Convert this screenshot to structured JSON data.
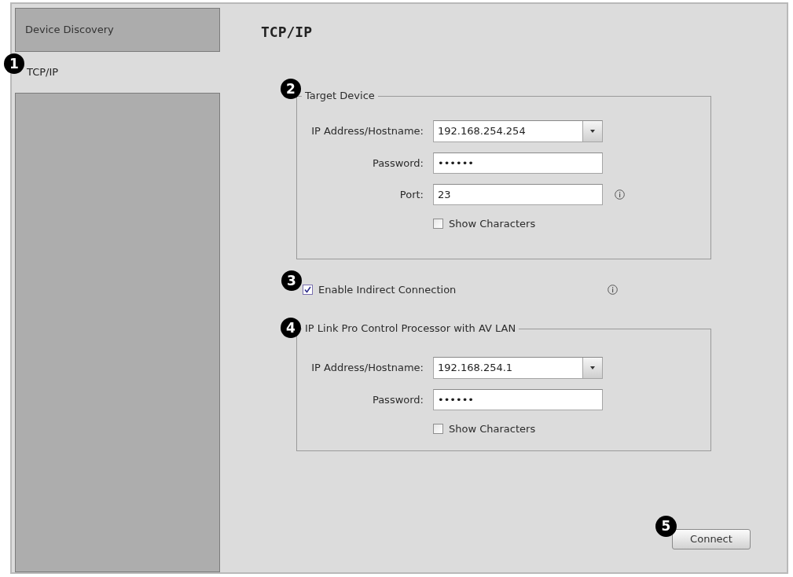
{
  "sidebar": {
    "items": [
      {
        "label": "Device Discovery",
        "selected": false
      },
      {
        "label": "TCP/IP",
        "selected": true,
        "callout": "1"
      }
    ]
  },
  "panel": {
    "title": "TCP/IP"
  },
  "target_device": {
    "title": "Target Device",
    "callout": "2",
    "fields": [
      {
        "kind": "combo",
        "label": "IP Address/Hostname:",
        "value": "192.168.254.254",
        "info": false
      },
      {
        "kind": "password",
        "label": "Password:",
        "value": "••••••",
        "info": false
      },
      {
        "kind": "text",
        "label": "Port:",
        "value": "23",
        "info": true
      }
    ],
    "show_characters": {
      "label": "Show Characters",
      "checked": false
    }
  },
  "indirect_connection": {
    "label": "Enable Indirect Connection",
    "checked": true,
    "info": true,
    "callout": "3"
  },
  "ip_link": {
    "title": "IP Link Pro Control Processor with AV LAN",
    "callout": "4",
    "fields": [
      {
        "kind": "combo",
        "label": "IP Address/Hostname:",
        "value": "192.168.254.1",
        "info": false
      },
      {
        "kind": "password",
        "label": "Password:",
        "value": "••••••",
        "info": false
      }
    ],
    "show_characters": {
      "label": "Show Characters",
      "checked": false
    }
  },
  "connect_button": {
    "label": "Connect",
    "callout": "5"
  }
}
